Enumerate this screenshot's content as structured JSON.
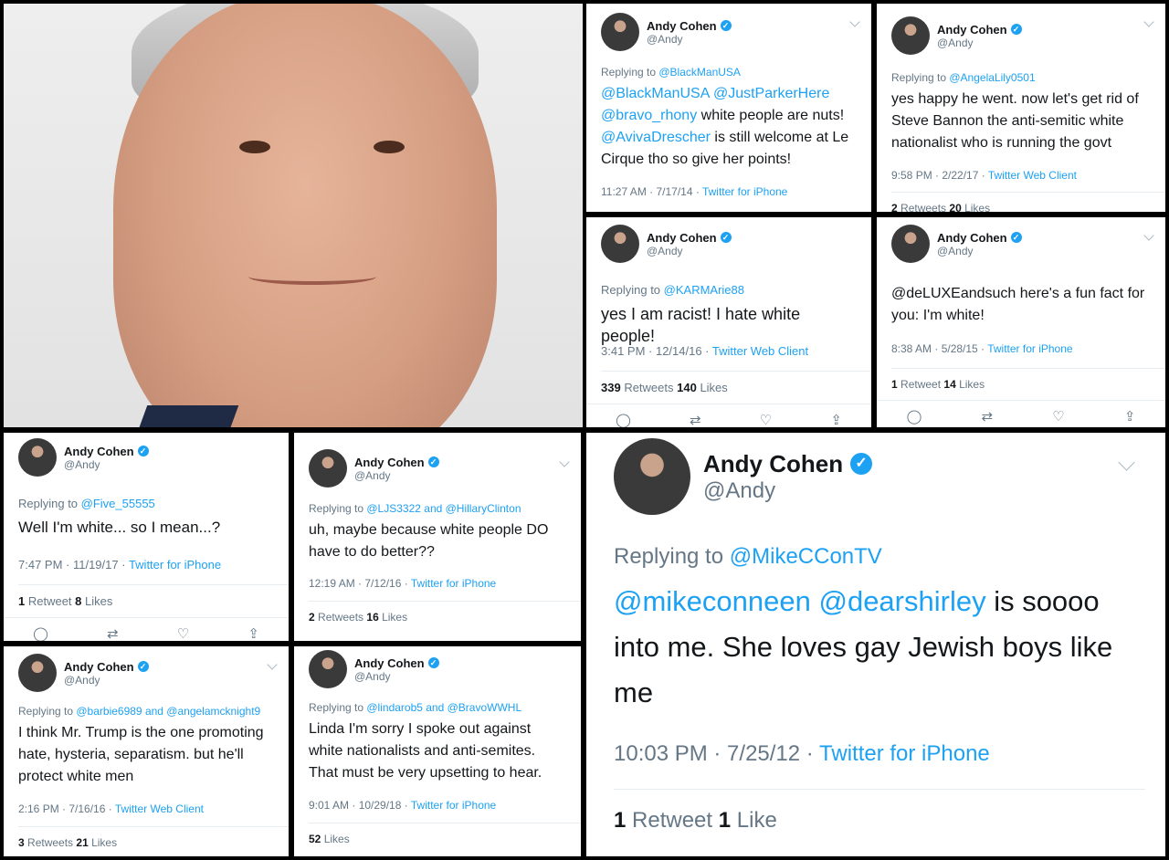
{
  "author": {
    "name": "Andy Cohen",
    "handle": "@Andy",
    "verified_icon": "verified-badge-icon"
  },
  "tweets": [
    {
      "id": "t1",
      "replying_prefix": "Replying to ",
      "replying": "@BlackManUSA",
      "mentions": "@BlackManUSA @JustParkerHere @bravo_rhony",
      "text_a": " white people are nuts! ",
      "mention2": "@AvivaDrescher",
      "text_b": " is still welcome at Le Cirque tho so give her points!",
      "time": "11:27 AM · 7/17/14 · ",
      "client": "Twitter for iPhone"
    },
    {
      "id": "t2",
      "replying_prefix": "Replying to ",
      "replying": "@AngelaLily0501",
      "text": "yes happy he went. now let's get rid of Steve Bannon the anti-semitic white nationalist who is running the govt",
      "time": "9:58 PM · 2/22/17 · ",
      "client": "Twitter Web Client",
      "retweets": "2",
      "retweets_label": " Retweets ",
      "likes": "20",
      "likes_label": " Likes"
    },
    {
      "id": "t3",
      "replying_prefix": "Replying to ",
      "replying": "@KARMArie88",
      "text": "yes I am racist! I hate white people!",
      "time": "3:41 PM · 12/14/16 · ",
      "client": "Twitter Web Client",
      "retweets": "339",
      "retweets_label": " Retweets ",
      "likes": "140",
      "likes_label": " Likes"
    },
    {
      "id": "t4",
      "mention": "@deLUXEandsuch",
      "text": " here's a fun fact for you: I'm white!",
      "time": "8:38 AM · 5/28/15 · ",
      "client": "Twitter for iPhone",
      "retweets": "1",
      "retweets_label": " Retweet ",
      "likes": "14",
      "likes_label": " Likes"
    },
    {
      "id": "t5",
      "replying_prefix": "Replying to ",
      "replying": "@Five_55555",
      "text": "Well I'm white... so I mean...?",
      "time": "7:47 PM · 11/19/17 · ",
      "client": "Twitter for iPhone",
      "retweets": "1",
      "retweets_label": " Retweet ",
      "likes": "8",
      "likes_label": " Likes"
    },
    {
      "id": "t6",
      "replying_prefix": "Replying to ",
      "replying": "@LJS3322 and @HillaryClinton",
      "text": "uh, maybe because white people DO have to do better??",
      "time": "12:19 AM · 7/12/16 · ",
      "client": "Twitter for iPhone",
      "retweets": "2",
      "retweets_label": " Retweets ",
      "likes": "16",
      "likes_label": " Likes"
    },
    {
      "id": "t7",
      "replying_prefix": "Replying to ",
      "replying": "@barbie6989 and @angelamcknight9",
      "text": "I think Mr. Trump is the one promoting hate, hysteria, separatism. but he'll protect white men",
      "time": "2:16 PM · 7/16/16 · ",
      "client": "Twitter Web Client",
      "retweets": "3",
      "retweets_label": " Retweets ",
      "likes": "21",
      "likes_label": " Likes"
    },
    {
      "id": "t8",
      "replying_prefix": "Replying to ",
      "replying": "@lindarob5 and @BravoWWHL",
      "text": "Linda I'm sorry I spoke out against white nationalists and anti-semites. That must be very upsetting to hear.",
      "time": "9:01 AM · 10/29/18 · ",
      "client": "Twitter for iPhone",
      "likes": "52",
      "likes_label": " Likes"
    },
    {
      "id": "t9",
      "replying_prefix": "Replying to ",
      "replying": "@MikeCConTV",
      "mentions": "@mikeconneen @dearshirley",
      "text": " is soooo into me.  She loves gay Jewish boys like me",
      "time": "10:03 PM · 7/25/12 · ",
      "client": "Twitter for iPhone",
      "retweets": "1",
      "retweets_label": " Retweet ",
      "likes": "1",
      "likes_label": " Like"
    }
  ],
  "actions": {
    "reply": "reply-icon",
    "retweet": "retweet-icon",
    "like": "like-icon",
    "share": "share-icon"
  },
  "colors": {
    "link": "#1da1f2",
    "muted": "#657786",
    "verified": "#1da1f2"
  }
}
